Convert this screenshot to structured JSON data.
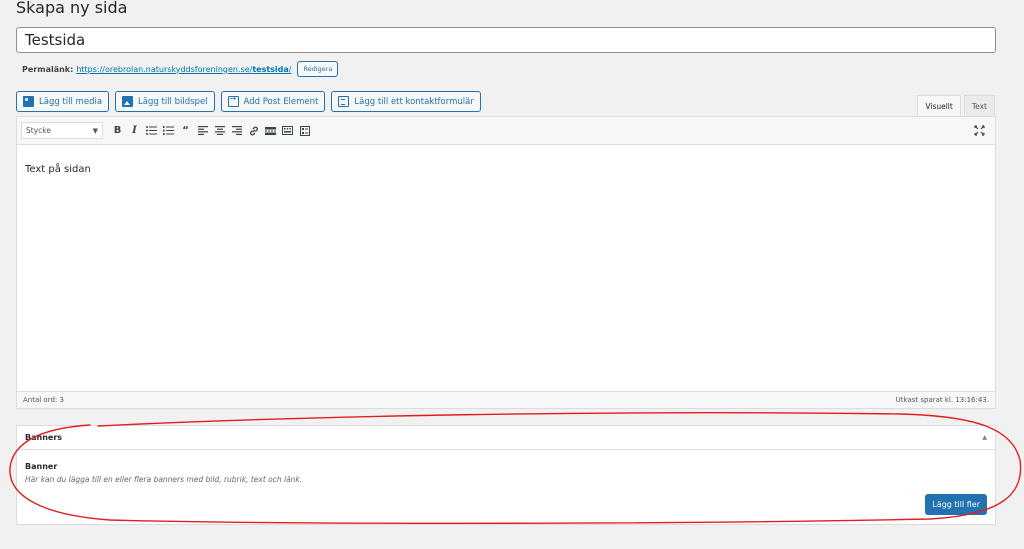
{
  "page": {
    "title": "Skapa ny sida"
  },
  "post": {
    "title": "Testsida"
  },
  "permalink": {
    "label": "Permalänk:",
    "url_base": "https://orebrolan.naturskyddsforeningen.se/",
    "slug": "testsida",
    "url_trail": "/",
    "edit_label": "Redigera"
  },
  "media_buttons": {
    "add_media": "Lägg till media",
    "add_gallery": "Lägg till bildspel",
    "add_post_element": "Add Post Element",
    "add_contact_form": "Lägg till ett kontaktformulär"
  },
  "editor_tabs": {
    "visual": "Visuellt",
    "text": "Text"
  },
  "toolbar": {
    "format_value": "Stycke",
    "icons": [
      "bold-icon",
      "italic-icon",
      "bullet-list-icon",
      "numbered-list-icon",
      "blockquote-icon",
      "align-left-icon",
      "align-center-icon",
      "align-right-icon",
      "link-icon",
      "read-more-icon",
      "toolbar-toggle-icon",
      "form-icon",
      "fullscreen-icon"
    ]
  },
  "editor": {
    "content": "Text på sidan",
    "word_count": "Antal ord: 3",
    "draft_saved": "Utkast sparat kl. 13:16:43."
  },
  "banners": {
    "header": "Banners",
    "item_title": "Banner",
    "item_description": "Här kan du lägga till en eller flera banners med bild, rubrik, text och länk.",
    "add_more": "Lägg till fler"
  },
  "colors": {
    "accent": "#2271b1",
    "annotation": "#e02020"
  }
}
